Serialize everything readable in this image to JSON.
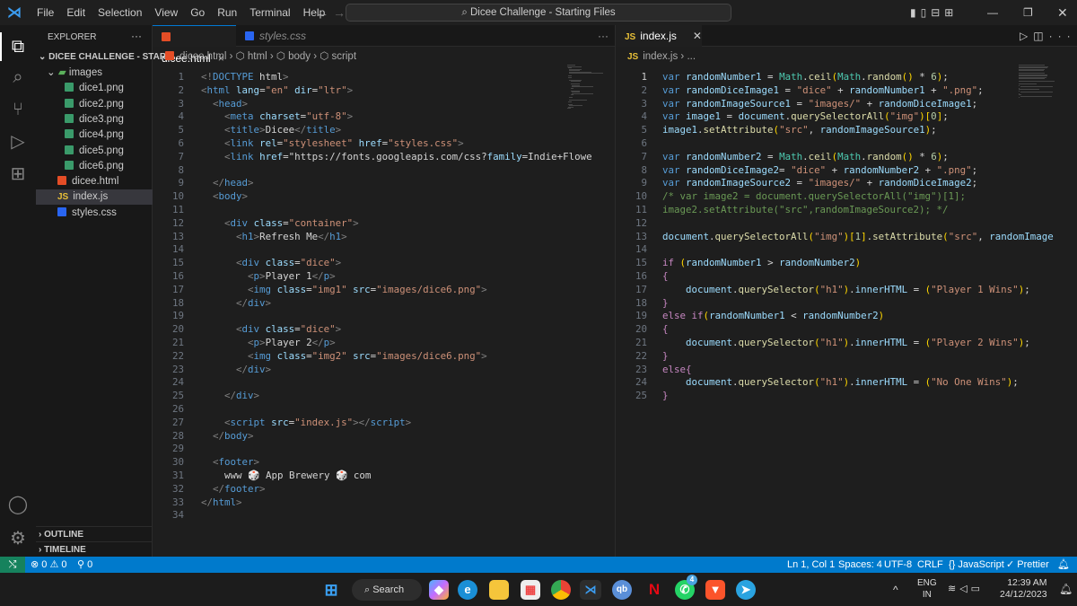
{
  "titlebar": {
    "menus": [
      "File",
      "Edit",
      "Selection",
      "View",
      "Go",
      "Run",
      "Terminal",
      "Help"
    ],
    "search": "Dicee Challenge - Starting Files"
  },
  "sidebar": {
    "title": "EXPLORER",
    "more": "···",
    "project": "DICEE CHALLENGE - START...",
    "items": [
      {
        "label": "images",
        "type": "folder"
      },
      {
        "label": "dice1.png",
        "type": "png"
      },
      {
        "label": "dice2.png",
        "type": "png"
      },
      {
        "label": "dice3.png",
        "type": "png"
      },
      {
        "label": "dice4.png",
        "type": "png"
      },
      {
        "label": "dice5.png",
        "type": "png"
      },
      {
        "label": "dice6.png",
        "type": "png"
      },
      {
        "label": "dicee.html",
        "type": "html"
      },
      {
        "label": "index.js",
        "type": "js",
        "selected": true
      },
      {
        "label": "styles.css",
        "type": "css"
      }
    ],
    "outline": "OUTLINE",
    "timeline": "TIMELINE"
  },
  "left_editor": {
    "tabs": [
      {
        "label": "dicee.html",
        "active": true
      },
      {
        "label": "styles.css",
        "active": false
      }
    ],
    "breadcrumb": [
      "dicee.html",
      "html",
      "body",
      "script"
    ],
    "lines": [
      "<!DOCTYPE html>",
      "<html lang=\"en\" dir=\"ltr\">",
      "  <head>",
      "    <meta charset=\"utf-8\">",
      "    <title>Dicee</title>",
      "    <link rel=\"stylesheet\" href=\"styles.css\">",
      "    <link href=\"https://fonts.googleapis.com/css?family=Indie+Flowe",
      "",
      "  </head>",
      "  <body>",
      "",
      "    <div class=\"container\">",
      "      <h1>Refresh Me</h1>",
      "",
      "      <div class=\"dice\">",
      "        <p>Player 1</p>",
      "        <img class=\"img1\" src=\"images/dice6.png\">",
      "      </div>",
      "",
      "      <div class=\"dice\">",
      "        <p>Player 2</p>",
      "        <img class=\"img2\" src=\"images/dice6.png\">",
      "      </div>",
      "",
      "    </div>",
      "",
      "    <script src=\"index.js\"></script>",
      "  </body>",
      "",
      "  <footer>",
      "    www 🎲 App Brewery 🎲 com",
      "  </footer>",
      "</html>",
      ""
    ]
  },
  "right_editor": {
    "tab": "index.js",
    "breadcrumb": [
      "index.js",
      "..."
    ],
    "lines": [
      "var randomNumber1 = Math.ceil(Math.random() * 6);",
      "var randomDiceImage1 = \"dice\" + randomNumber1 + \".png\";",
      "var randomImageSource1 = \"images/\" + randomDiceImage1;",
      "var image1 = document.querySelectorAll(\"img\")[0];",
      "image1.setAttribute(\"src\", randomImageSource1);",
      "",
      "var randomNumber2 = Math.ceil(Math.random() * 6);",
      "var randomDiceImage2= \"dice\" + randomNumber2 + \".png\";",
      "var randomImageSource2 = \"images/\" + randomDiceImage2;",
      "/* var image2 = document.querySelectorAll(\"img\")[1];",
      "image2.setAttribute(\"src\",randomImageSource2); */",
      "",
      "document.querySelectorAll(\"img\")[1].setAttribute(\"src\", randomImage",
      "",
      "if (randomNumber1 > randomNumber2)",
      "{",
      "    document.querySelector(\"h1\").innerHTML = (\"Player 1 Wins\");",
      "}",
      "else if(randomNumber1 < randomNumber2)",
      "{",
      "    document.querySelector(\"h1\").innerHTML = (\"Player 2 Wins\");",
      "}",
      "else{",
      "    document.querySelector(\"h1\").innerHTML = (\"No One Wins\");",
      "}"
    ]
  },
  "status": {
    "errors": "0",
    "warnings": "0",
    "ports": "0",
    "position": "Ln 1, Col 1",
    "spaces": "Spaces: 4",
    "encoding": "UTF-8",
    "eol": "CRLF",
    "language": "JavaScript",
    "formatter": "Prettier"
  },
  "taskbar": {
    "search": "Search",
    "lang1": "ENG",
    "lang2": "IN",
    "time": "12:39 AM",
    "date": "24/12/2023",
    "whatsapp_badge": "4"
  },
  "colors": {
    "status": "#007acc",
    "remote": "#16825d"
  }
}
